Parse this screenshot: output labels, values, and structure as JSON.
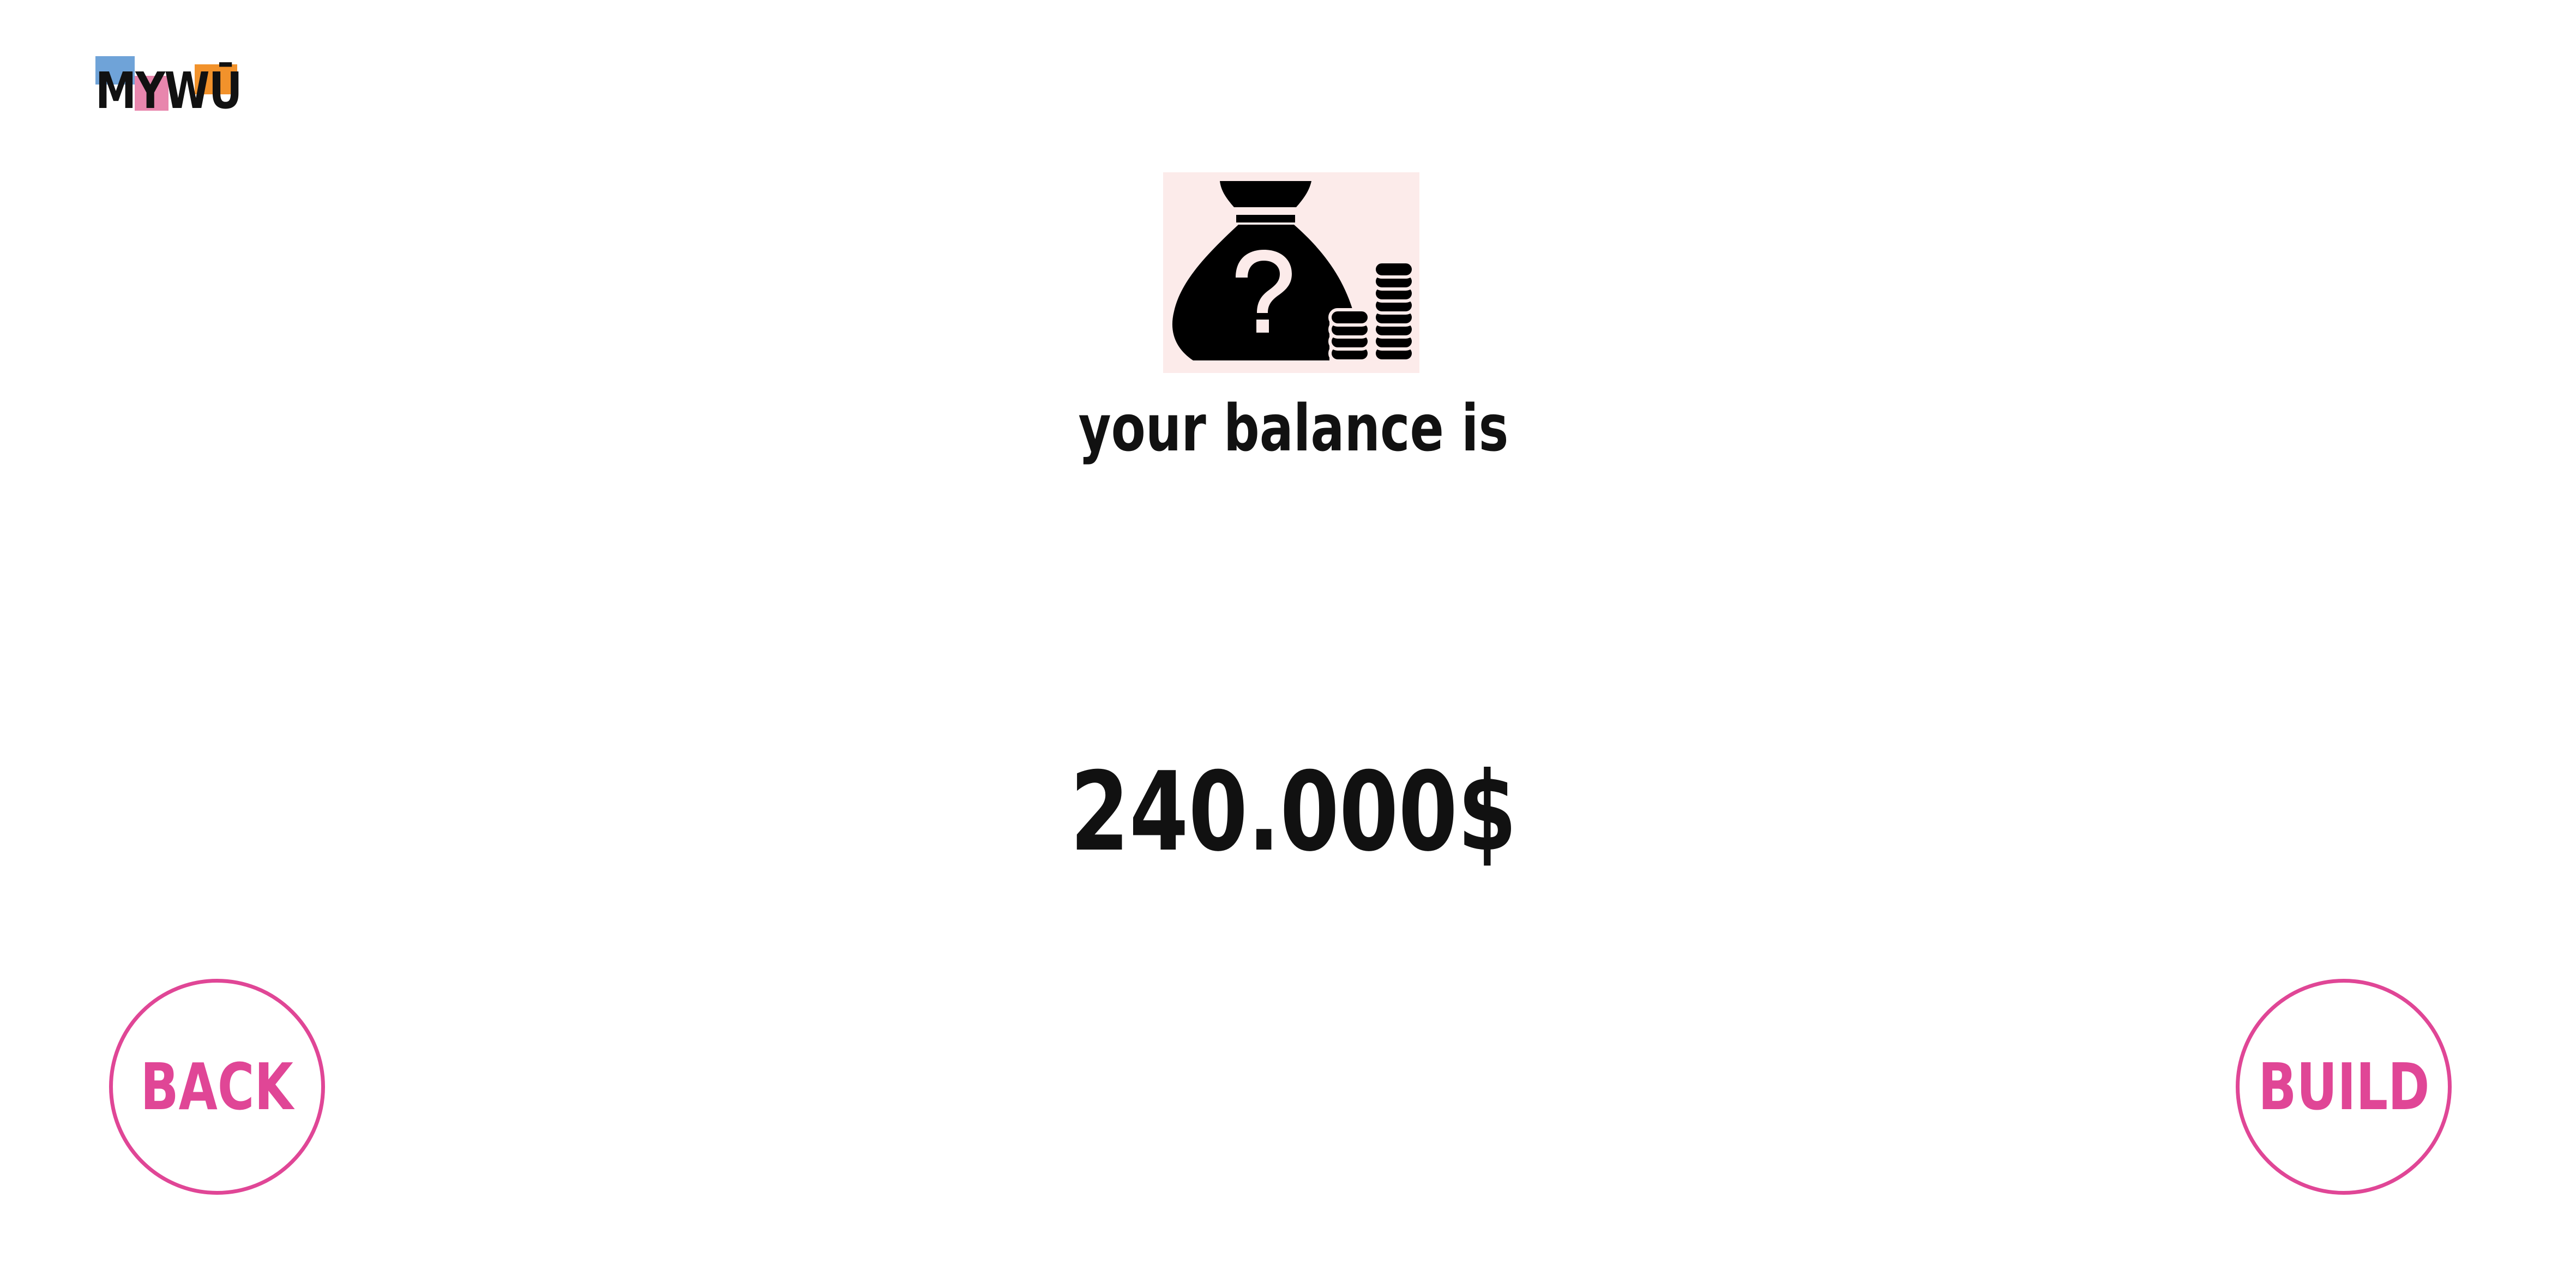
{
  "logo": {
    "text": "MYWŪ",
    "colors": {
      "blue": "#6fa3d8",
      "pink": "#e886ad",
      "orange": "#f2922b"
    }
  },
  "illustration": {
    "icon": "money-bag-question-icon",
    "background": "#fcebea"
  },
  "balance": {
    "label": "your balance is",
    "value": "240.000$"
  },
  "buttons": {
    "back_label": "BACK",
    "build_label": "BUILD",
    "accent": "#e04696"
  }
}
